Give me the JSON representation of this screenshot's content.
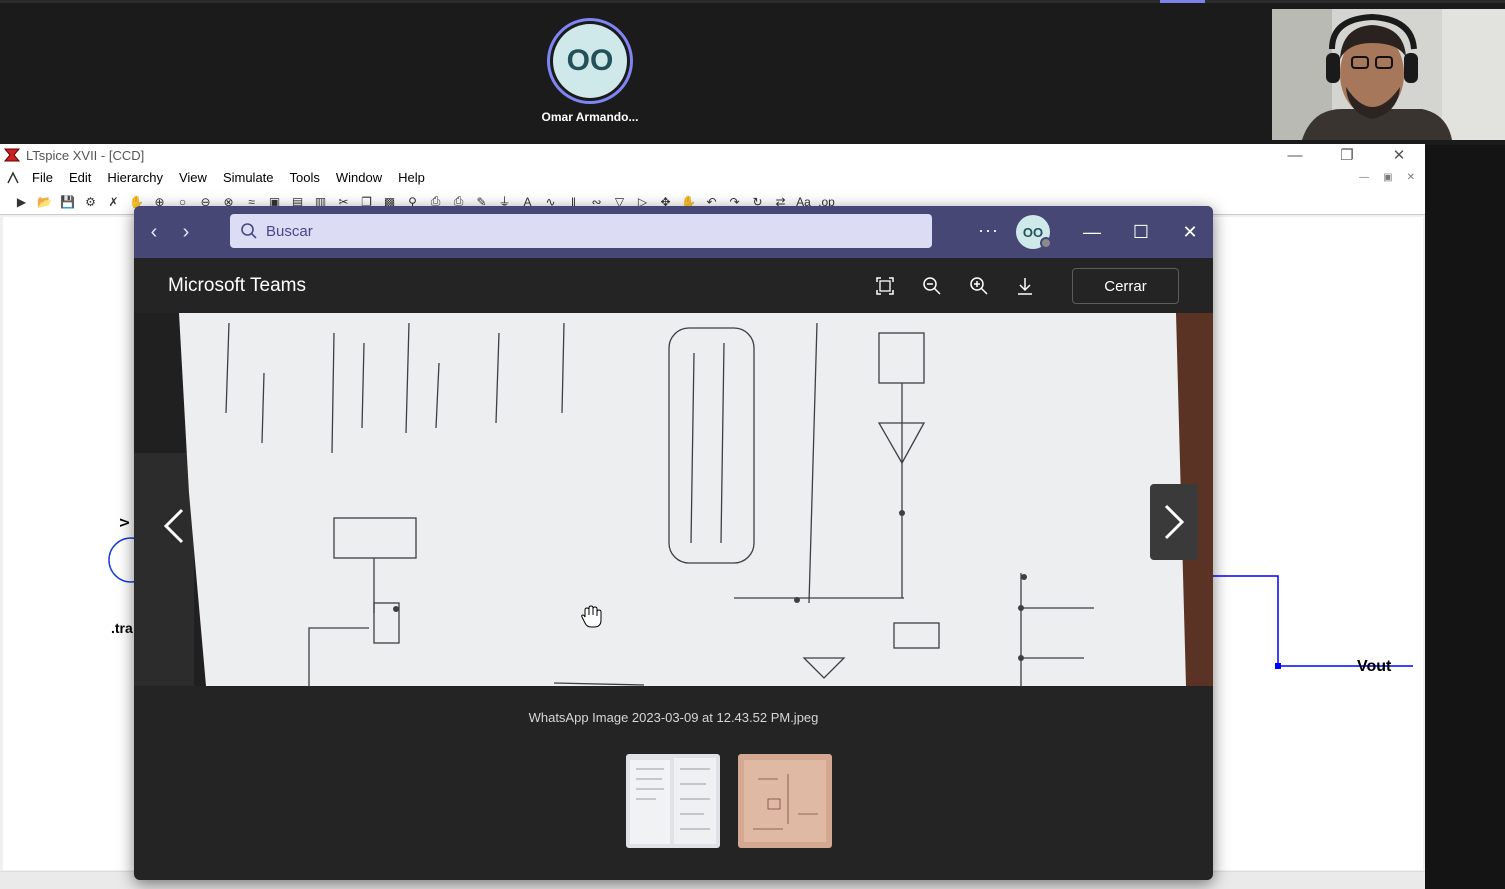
{
  "meeting": {
    "participant": {
      "initials": "OO",
      "name": "Omar Armando..."
    }
  },
  "ltspice": {
    "title": "LTspice XVII - [CCD]",
    "menu": [
      "File",
      "Edit",
      "Hierarchy",
      "View",
      "Simulate",
      "Tools",
      "Window",
      "Help"
    ],
    "labels": {
      "vout": "Vout",
      "tran": ".tra"
    }
  },
  "viewer": {
    "search_placeholder": "Buscar",
    "user_initials": "OO",
    "app_title": "Microsoft Teams",
    "close_label": "Cerrar",
    "filename": "WhatsApp Image 2023-03-09 at 12.43.52 PM.jpeg",
    "thumbnails": [
      "notebook-page-photo",
      "circuit-sketch-photo"
    ]
  },
  "colors": {
    "teams_purple": "#464775",
    "search_bg": "#dcdcf5",
    "avatar_bg": "#cfe8ea",
    "accent_ring": "#7f85f5",
    "wire_blue": "#0000ff"
  }
}
